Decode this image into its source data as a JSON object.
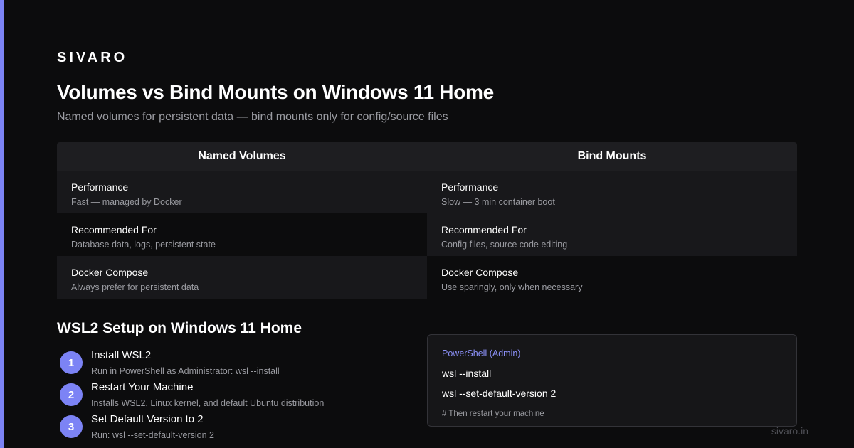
{
  "brand": "SIVARO",
  "title": "Volumes vs Bind Mounts on Windows 11 Home",
  "subtitle": "Named volumes for persistent data — bind mounts only for config/source files",
  "comparison": {
    "columns": [
      {
        "header": "Named Volumes",
        "rows": [
          {
            "label": "Performance",
            "value": "Fast — managed by Docker"
          },
          {
            "label": "Recommended For",
            "value": "Database data, logs, persistent state"
          },
          {
            "label": "Docker Compose",
            "value": "Always prefer for persistent data"
          }
        ]
      },
      {
        "header": "Bind Mounts",
        "rows": [
          {
            "label": "Performance",
            "value": "Slow — 3 min container boot"
          },
          {
            "label": "Recommended For",
            "value": "Config files, source code editing"
          },
          {
            "label": "Docker Compose",
            "value": "Use sparingly, only when necessary"
          }
        ]
      }
    ]
  },
  "setup": {
    "title": "WSL2 Setup on Windows 11 Home",
    "steps": [
      {
        "number": "1",
        "title": "Install WSL2",
        "description": "Run in PowerShell as Administrator: wsl --install"
      },
      {
        "number": "2",
        "title": "Restart Your Machine",
        "description": "Installs WSL2, Linux kernel, and default Ubuntu distribution"
      },
      {
        "number": "3",
        "title": "Set Default Version to 2",
        "description": "Run: wsl --set-default-version 2"
      }
    ]
  },
  "code_block": {
    "label": "PowerShell (Admin)",
    "lines": [
      "wsl --install",
      "wsl --set-default-version 2"
    ],
    "comment": "# Then restart your machine"
  },
  "footer": "sivaro.in",
  "colors": {
    "accent": "#7c83f5",
    "background": "#0c0c0d",
    "muted_text": "#9a9ba1"
  }
}
